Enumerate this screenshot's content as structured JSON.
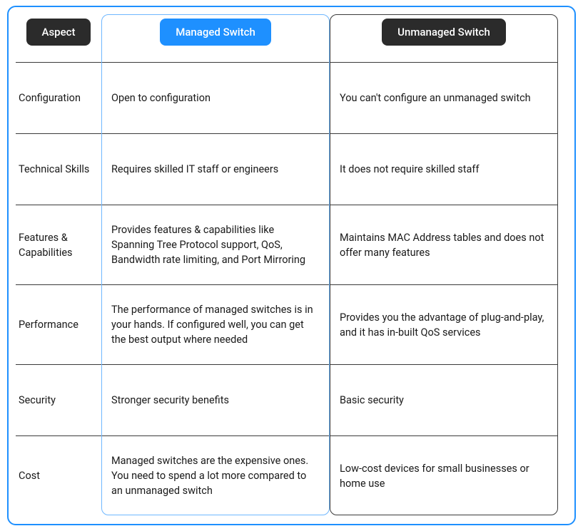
{
  "headers": {
    "aspect": "Aspect",
    "managed": "Managed Switch",
    "unmanaged": "Unmanaged Switch"
  },
  "rows": [
    {
      "aspect": "Configuration",
      "managed": "Open to configuration",
      "unmanaged": "You can't configure an unmanaged switch"
    },
    {
      "aspect": "Technical Skills",
      "managed": "Requires skilled IT staff or engineers",
      "unmanaged": "It does not require skilled staff"
    },
    {
      "aspect": "Features & Capabilities",
      "managed": "Provides features & capabilities like Spanning Tree Protocol support, QoS, Bandwidth rate limiting, and Port Mirroring",
      "unmanaged": "Maintains MAC Address tables and does not offer many features"
    },
    {
      "aspect": "Performance",
      "managed": "The performance of managed switches is in your hands. If configured well, you can get the best output where needed",
      "unmanaged": "Provides you the advantage of plug-and-play, and it has in-built QoS services"
    },
    {
      "aspect": "Security",
      "managed": "Stronger security benefits",
      "unmanaged": "Basic security"
    },
    {
      "aspect": "Cost",
      "managed": "Managed switches are the expensive ones. You need to spend a lot more compared to an unmanaged switch",
      "unmanaged": "Low-cost devices for small businesses or home use"
    }
  ]
}
